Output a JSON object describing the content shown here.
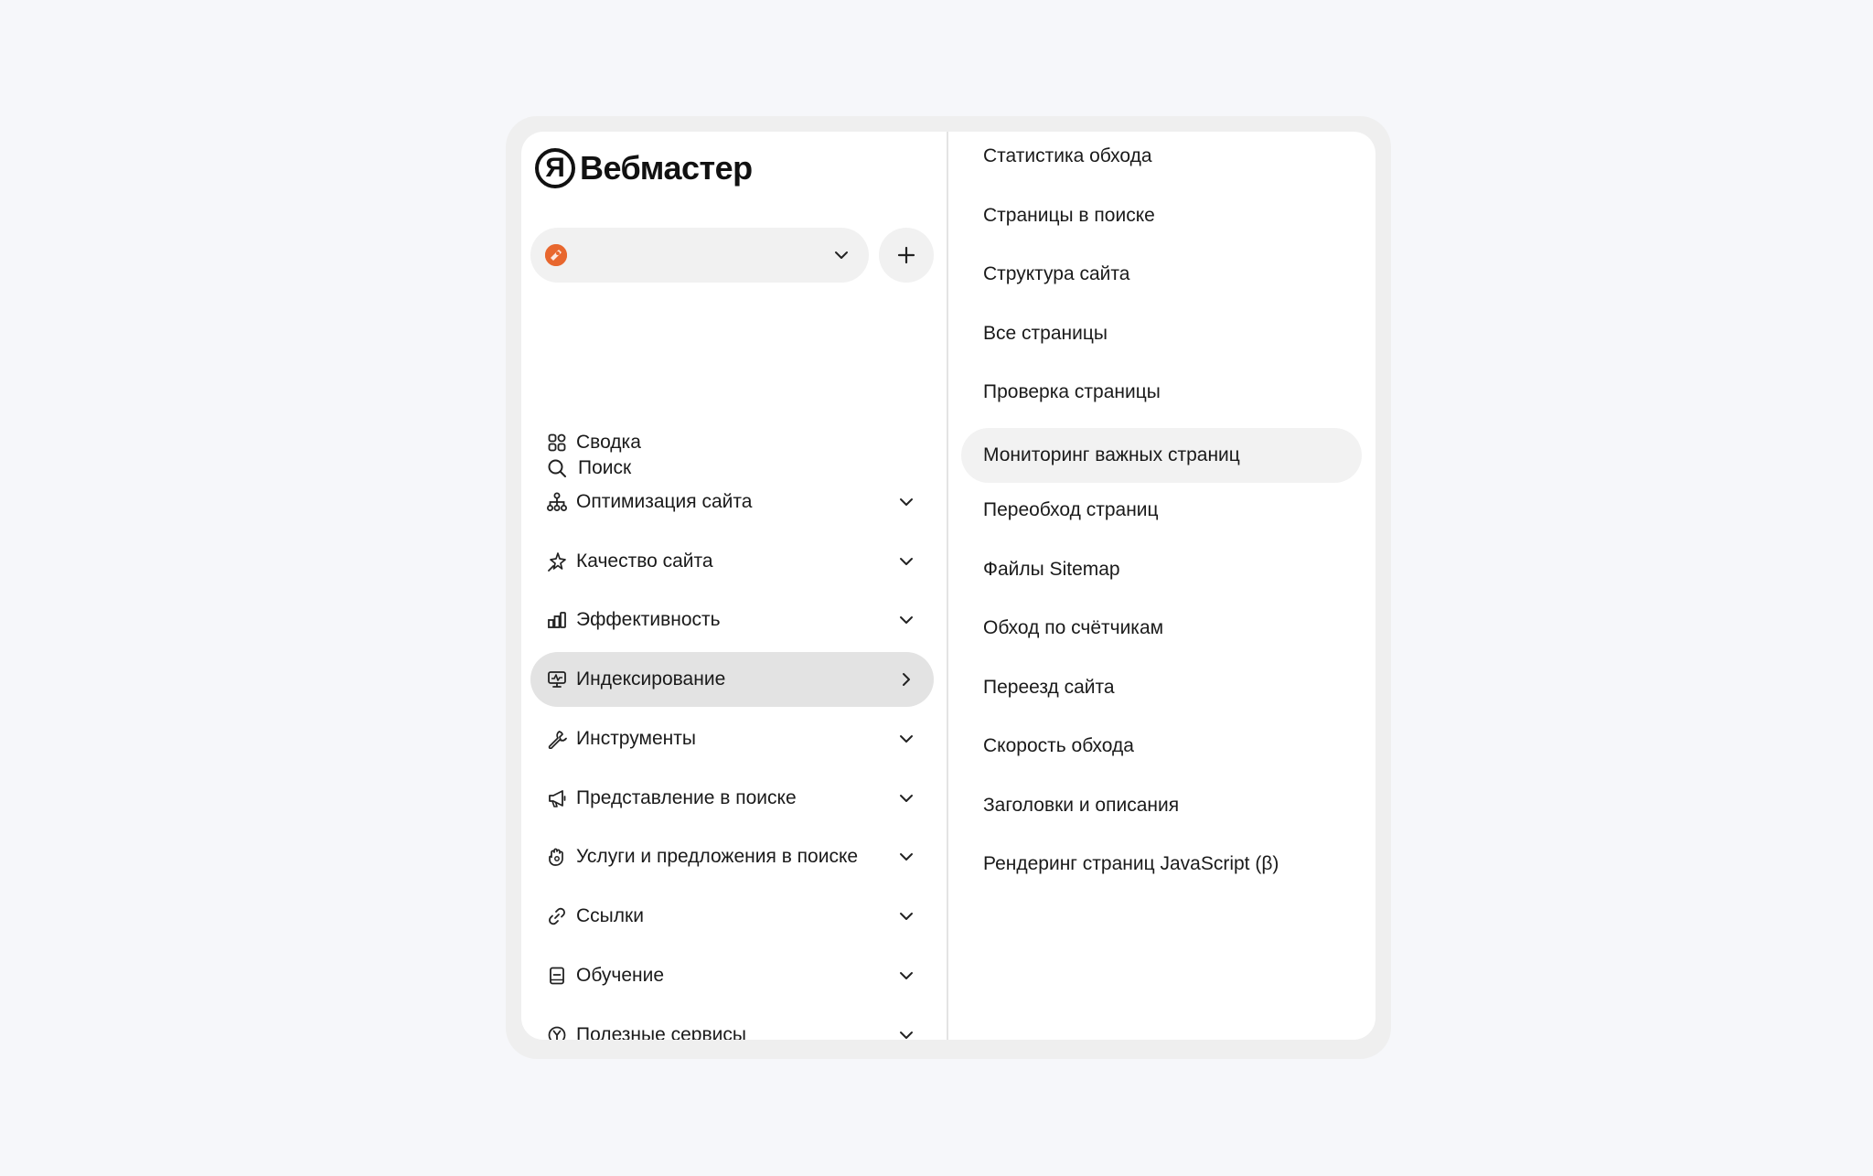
{
  "brand": {
    "logo_letter": "Я",
    "name": "Вебмастер"
  },
  "site_selector": {
    "favicon_color": "#e8672e",
    "value": ""
  },
  "search": {
    "label": "Поиск"
  },
  "nav": {
    "items": [
      {
        "label": "Сводка",
        "icon": "dashboard-icon"
      },
      {
        "label": "Оптимизация сайта",
        "icon": "sitemap-icon"
      },
      {
        "label": "Качество сайта",
        "icon": "sparkle-icon"
      },
      {
        "label": "Эффективность",
        "icon": "bar-chart-icon"
      },
      {
        "label": "Индексирование",
        "icon": "monitor-icon",
        "active": true
      },
      {
        "label": "Инструменты",
        "icon": "wrench-icon"
      },
      {
        "label": "Представление в поиске",
        "icon": "megaphone-icon"
      },
      {
        "label": "Услуги и предложения в поиске",
        "icon": "hand-icon"
      },
      {
        "label": "Ссылки",
        "icon": "link-icon"
      },
      {
        "label": "Обучение",
        "icon": "book-icon"
      },
      {
        "label": "Полезные сервисы",
        "icon": "yandex-circle-icon"
      }
    ]
  },
  "submenu": {
    "items": [
      "Статистика обхода",
      "Страницы в поиске",
      "Структура сайта",
      "Все страницы",
      "Проверка страницы",
      "Мониторинг важных страниц",
      "Переобход страниц",
      "Файлы Sitemap",
      "Обход по счётчикам",
      "Переезд сайта",
      "Скорость обхода",
      "Заголовки и описания",
      "Рендеринг страниц JavaScript (β)"
    ],
    "highlighted": "Мониторинг важных страниц"
  }
}
